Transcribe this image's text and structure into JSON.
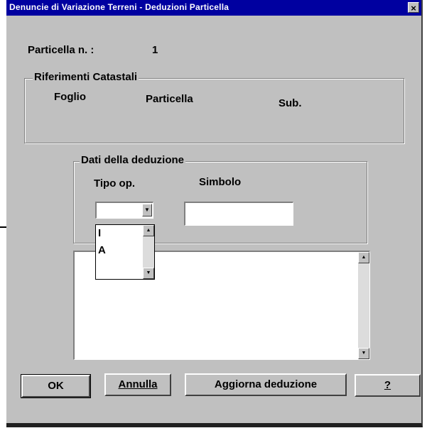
{
  "window": {
    "title": "Denuncie di Variazione Terreni - Deduzioni Particella",
    "close_glyph": "×"
  },
  "particella": {
    "label": "Particella n. :",
    "value": "1"
  },
  "riferimenti": {
    "legend": "Riferimenti Catastali",
    "foglio_label": "Foglio",
    "particella_label": "Particella",
    "sub_label": "Sub."
  },
  "deduzione": {
    "legend": "Dati della deduzione",
    "tipo_label": "Tipo op.",
    "simbolo_label": "Simbolo",
    "tipo_value": "",
    "simbolo_value": "",
    "tipo_options": [
      "I",
      "A"
    ]
  },
  "icons": {
    "combo_arrow": "▼",
    "scroll_up": "▲",
    "scroll_down": "▼"
  },
  "buttons": {
    "ok": "OK",
    "annulla": "Annulla",
    "aggiorna": "Aggiorna deduzione",
    "help": "?"
  }
}
